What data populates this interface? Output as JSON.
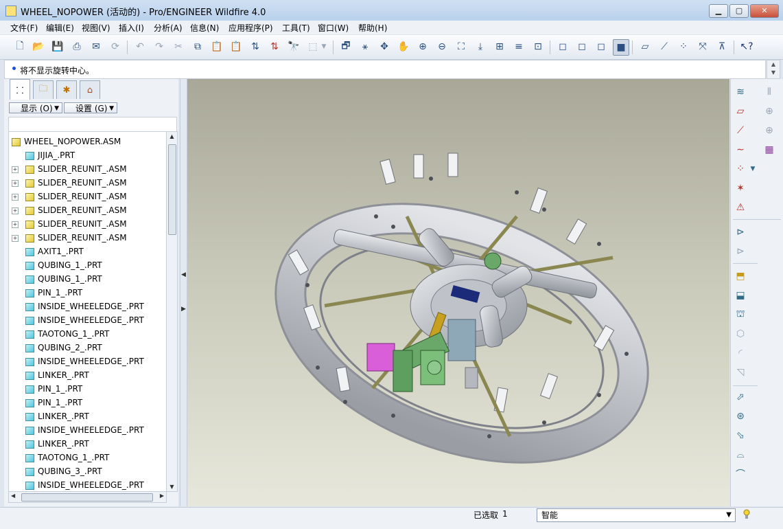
{
  "window": {
    "title": "WHEEL_NOPOWER (活动的) - Pro/ENGINEER Wildfire 4.0",
    "buttons": [
      "▁",
      "▢",
      "✕"
    ]
  },
  "menu": [
    "文件(F)",
    "编辑(E)",
    "视图(V)",
    "插入(I)",
    "分析(A)",
    "信息(N)",
    "应用程序(P)",
    "工具(T)",
    "窗口(W)",
    "帮助(H)"
  ],
  "message": "将不显示旋转中心。",
  "navigator": {
    "show_label": "显示 (O)",
    "settings_label": "设置 (G)",
    "tree": [
      {
        "name": "WHEEL_NOPOWER.ASM",
        "kind": "root"
      },
      {
        "name": "JIJIA_.PRT",
        "kind": "part"
      },
      {
        "name": "SLIDER_REUNIT_.ASM",
        "kind": "asm"
      },
      {
        "name": "SLIDER_REUNIT_.ASM",
        "kind": "asm"
      },
      {
        "name": "SLIDER_REUNIT_.ASM",
        "kind": "asm"
      },
      {
        "name": "SLIDER_REUNIT_.ASM",
        "kind": "asm"
      },
      {
        "name": "SLIDER_REUNIT_.ASM",
        "kind": "asm"
      },
      {
        "name": "SLIDER_REUNIT_.ASM",
        "kind": "asm"
      },
      {
        "name": "AXIT1_.PRT",
        "kind": "part"
      },
      {
        "name": "QUBING_1_.PRT",
        "kind": "part"
      },
      {
        "name": "QUBING_1_.PRT",
        "kind": "part"
      },
      {
        "name": "PIN_1_.PRT",
        "kind": "part"
      },
      {
        "name": "INSIDE_WHEELEDGE_.PRT",
        "kind": "part"
      },
      {
        "name": "INSIDE_WHEELEDGE_.PRT",
        "kind": "part"
      },
      {
        "name": "TAOTONG_1_.PRT",
        "kind": "part"
      },
      {
        "name": "QUBING_2_.PRT",
        "kind": "part"
      },
      {
        "name": "INSIDE_WHEELEDGE_.PRT",
        "kind": "part"
      },
      {
        "name": "LINKER_.PRT",
        "kind": "part"
      },
      {
        "name": "PIN_1_.PRT",
        "kind": "part"
      },
      {
        "name": "PIN_1_.PRT",
        "kind": "part"
      },
      {
        "name": "LINKER_.PRT",
        "kind": "part"
      },
      {
        "name": "INSIDE_WHEELEDGE_.PRT",
        "kind": "part"
      },
      {
        "name": "LINKER_.PRT",
        "kind": "part"
      },
      {
        "name": "TAOTONG_1_.PRT",
        "kind": "part"
      },
      {
        "name": "QUBING_3_.PRT",
        "kind": "part"
      },
      {
        "name": "INSIDE_WHEELEDGE_.PRT",
        "kind": "part"
      }
    ]
  },
  "status": {
    "selected_label": "已选取",
    "selected_count": "1",
    "filter_value": "智能"
  },
  "colors": {
    "accent": "#1f4fd8",
    "model_metal": "#c9ccd2",
    "model_rod": "#8a8850",
    "model_green": "#6aa86a",
    "model_magenta": "#d85fd8",
    "model_gold": "#c8a020"
  }
}
